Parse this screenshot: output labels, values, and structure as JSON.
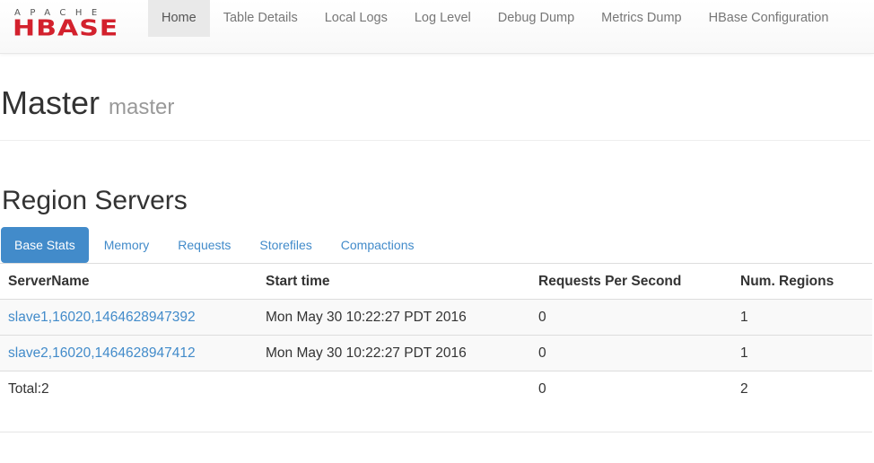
{
  "navbar": {
    "logo": {
      "top": "APACHE",
      "main": "HBASE"
    },
    "items": [
      {
        "label": "Home",
        "active": true
      },
      {
        "label": "Table Details"
      },
      {
        "label": "Local Logs"
      },
      {
        "label": "Log Level"
      },
      {
        "label": "Debug Dump"
      },
      {
        "label": "Metrics Dump"
      },
      {
        "label": "HBase Configuration"
      }
    ]
  },
  "header": {
    "title": "Master",
    "subtitle": "master"
  },
  "region_servers": {
    "title": "Region Servers",
    "tabs": [
      {
        "label": "Base Stats",
        "active": true
      },
      {
        "label": "Memory"
      },
      {
        "label": "Requests"
      },
      {
        "label": "Storefiles"
      },
      {
        "label": "Compactions"
      }
    ],
    "columns": [
      "ServerName",
      "Start time",
      "Requests Per Second",
      "Num. Regions"
    ],
    "rows": [
      {
        "server": "slave1,16020,1464628947392",
        "start": "Mon May 30 10:22:27 PDT 2016",
        "rps": "0",
        "regions": "1"
      },
      {
        "server": "slave2,16020,1464628947412",
        "start": "Mon May 30 10:22:27 PDT 2016",
        "rps": "0",
        "regions": "1"
      }
    ],
    "total": {
      "label": "Total:2",
      "rps": "0",
      "regions": "2"
    }
  },
  "colors": {
    "link": "#428bca",
    "active_tab": "#428bca",
    "logo_red": "#d3212d"
  }
}
